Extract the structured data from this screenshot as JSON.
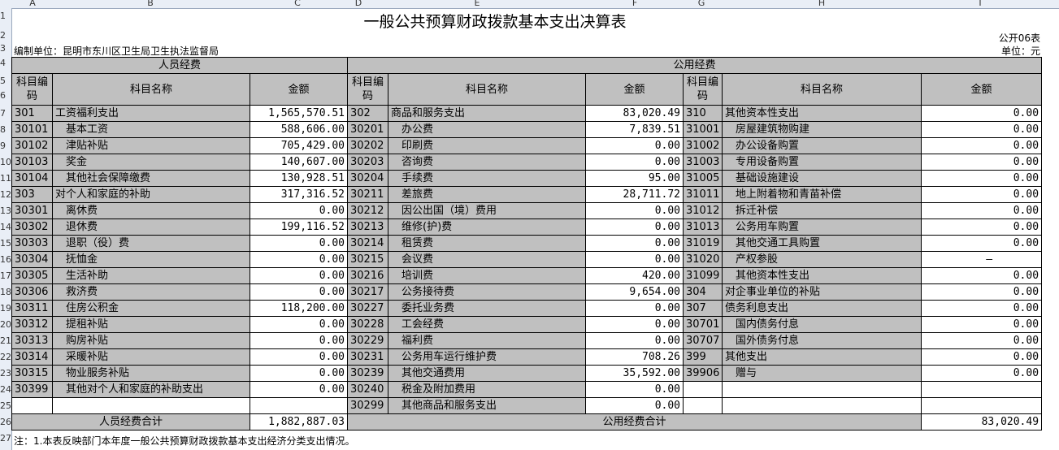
{
  "column_letters": [
    "A",
    "B",
    "C",
    "D",
    "E",
    "F",
    "G",
    "H",
    "I"
  ],
  "row_numbers": [
    "1",
    "2",
    "3",
    "4",
    "5",
    "6",
    "7",
    "8",
    "9",
    "10",
    "11",
    "12",
    "13",
    "14",
    "15",
    "16",
    "17",
    "18",
    "19",
    "20",
    "21",
    "22",
    "23",
    "24",
    "25",
    "26",
    "27"
  ],
  "title": "一般公共预算财政拨款基本支出决算表",
  "form_no": "公开06表",
  "unit_org": "编制单位：昆明市东川区卫生局卫生执法监督局",
  "unit": "单位：元",
  "headers": {
    "personnel": "人员经费",
    "public": "公用经费",
    "code": "科目编码",
    "name": "科目名称",
    "amount": "金额"
  },
  "rows": [
    {
      "c1": "301",
      "n1": "工资福利支出",
      "a1": "1,565,570.51",
      "i1": false,
      "c2": "302",
      "n2": "商品和服务支出",
      "a2": "83,020.49",
      "i2": false,
      "c3": "310",
      "n3": "其他资本性支出",
      "a3": "0.00",
      "i3": false
    },
    {
      "c1": "30101",
      "n1": "基本工资",
      "a1": "588,606.00",
      "i1": true,
      "c2": "30201",
      "n2": "办公费",
      "a2": "7,839.51",
      "i2": true,
      "c3": "31001",
      "n3": "房屋建筑物购建",
      "a3": "0.00",
      "i3": true
    },
    {
      "c1": "30102",
      "n1": "津贴补贴",
      "a1": "705,429.00",
      "i1": true,
      "c2": "30202",
      "n2": "印刷费",
      "a2": "0.00",
      "i2": true,
      "c3": "31002",
      "n3": "办公设备购置",
      "a3": "0.00",
      "i3": true
    },
    {
      "c1": "30103",
      "n1": "奖金",
      "a1": "140,607.00",
      "i1": true,
      "c2": "30203",
      "n2": "咨询费",
      "a2": "0.00",
      "i2": true,
      "c3": "31003",
      "n3": "专用设备购置",
      "a3": "0.00",
      "i3": true
    },
    {
      "c1": "30104",
      "n1": "其他社会保障缴费",
      "a1": "130,928.51",
      "i1": true,
      "c2": "30204",
      "n2": "手续费",
      "a2": "95.00",
      "i2": true,
      "c3": "31005",
      "n3": "基础设施建设",
      "a3": "0.00",
      "i3": true
    },
    {
      "c1": "303",
      "n1": "对个人和家庭的补助",
      "a1": "317,316.52",
      "i1": false,
      "c2": "30211",
      "n2": "差旅费",
      "a2": "28,711.72",
      "i2": true,
      "c3": "31011",
      "n3": "地上附着物和青苗补偿",
      "a3": "0.00",
      "i3": true
    },
    {
      "c1": "30301",
      "n1": "离休费",
      "a1": "0.00",
      "i1": true,
      "c2": "30212",
      "n2": "因公出国（境）费用",
      "a2": "0.00",
      "i2": true,
      "c3": "31012",
      "n3": "拆迁补偿",
      "a3": "0.00",
      "i3": true
    },
    {
      "c1": "30302",
      "n1": "退休费",
      "a1": "199,116.52",
      "i1": true,
      "c2": "30213",
      "n2": "维修(护)费",
      "a2": "0.00",
      "i2": true,
      "c3": "31013",
      "n3": "公务用车购置",
      "a3": "0.00",
      "i3": true
    },
    {
      "c1": "30303",
      "n1": "退职（役）费",
      "a1": "0.00",
      "i1": true,
      "c2": "30214",
      "n2": "租赁费",
      "a2": "0.00",
      "i2": true,
      "c3": "31019",
      "n3": "其他交通工具购置",
      "a3": "0.00",
      "i3": true
    },
    {
      "c1": "30304",
      "n1": "抚恤金",
      "a1": "0.00",
      "i1": true,
      "c2": "30215",
      "n2": "会议费",
      "a2": "0.00",
      "i2": true,
      "c3": "31020",
      "n3": "产权参股",
      "a3": "—",
      "i3": true
    },
    {
      "c1": "30305",
      "n1": "生活补助",
      "a1": "0.00",
      "i1": true,
      "c2": "30216",
      "n2": "培训费",
      "a2": "420.00",
      "i2": true,
      "c3": "31099",
      "n3": "其他资本性支出",
      "a3": "0.00",
      "i3": true
    },
    {
      "c1": "30306",
      "n1": "救济费",
      "a1": "0.00",
      "i1": true,
      "c2": "30217",
      "n2": "公务接待费",
      "a2": "9,654.00",
      "i2": true,
      "c3": "304",
      "n3": "对企事业单位的补贴",
      "a3": "0.00",
      "i3": false
    },
    {
      "c1": "30311",
      "n1": "住房公积金",
      "a1": "118,200.00",
      "i1": true,
      "c2": "30227",
      "n2": "委托业务费",
      "a2": "0.00",
      "i2": true,
      "c3": "307",
      "n3": "债务利息支出",
      "a3": "0.00",
      "i3": false
    },
    {
      "c1": "30312",
      "n1": "提租补贴",
      "a1": "0.00",
      "i1": true,
      "c2": "30228",
      "n2": "工会经费",
      "a2": "0.00",
      "i2": true,
      "c3": "30701",
      "n3": "国内债务付息",
      "a3": "0.00",
      "i3": true
    },
    {
      "c1": "30313",
      "n1": "购房补贴",
      "a1": "0.00",
      "i1": true,
      "c2": "30229",
      "n2": "福利费",
      "a2": "0.00",
      "i2": true,
      "c3": "30707",
      "n3": "国外债务付息",
      "a3": "0.00",
      "i3": true
    },
    {
      "c1": "30314",
      "n1": "采暖补贴",
      "a1": "0.00",
      "i1": true,
      "c2": "30231",
      "n2": "公务用车运行维护费",
      "a2": "708.26",
      "i2": true,
      "c3": "399",
      "n3": "其他支出",
      "a3": "0.00",
      "i3": false
    },
    {
      "c1": "30315",
      "n1": "物业服务补贴",
      "a1": "0.00",
      "i1": true,
      "c2": "30239",
      "n2": "其他交通费用",
      "a2": "35,592.00",
      "i2": true,
      "c3": "39906",
      "n3": "赠与",
      "a3": "0.00",
      "i3": true
    },
    {
      "c1": "30399",
      "n1": "其他对个人和家庭的补助支出",
      "a1": "0.00",
      "i1": true,
      "c2": "30240",
      "n2": "税金及附加费用",
      "a2": "0.00",
      "i2": true,
      "c3": "",
      "n3": "",
      "a3": "",
      "i3": false
    },
    {
      "c1": "",
      "n1": "",
      "a1": "",
      "i1": false,
      "c2": "30299",
      "n2": "其他商品和服务支出",
      "a2": "0.00",
      "i2": true,
      "c3": "",
      "n3": "",
      "a3": "",
      "i3": false
    }
  ],
  "totals": {
    "personnel_label": "人员经费合计",
    "personnel_value": "1,882,887.03",
    "public_label": "公用经费合计",
    "public_value": "83,020.49"
  },
  "footnote": "注：1.本表反映部门本年度一般公共预算财政拨款基本支出经济分类支出情况。"
}
